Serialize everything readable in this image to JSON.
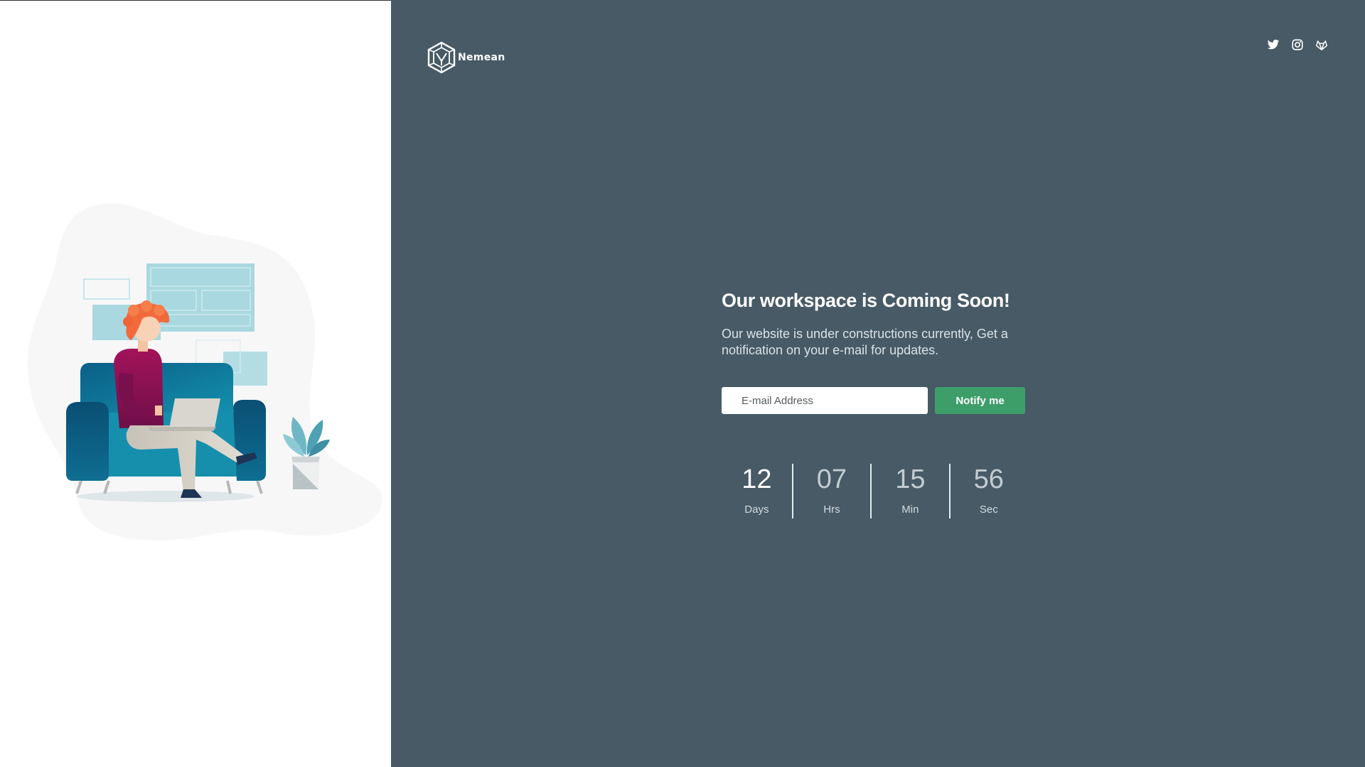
{
  "brand": {
    "name": "Nemean"
  },
  "social": {
    "items": [
      {
        "name": "twitter-icon"
      },
      {
        "name": "instagram-icon"
      },
      {
        "name": "gitlab-icon"
      }
    ]
  },
  "hero": {
    "headline": "Our workspace is Coming Soon!",
    "lead": "Our website is under constructions currently, Get a notification on your e-mail for updates."
  },
  "form": {
    "email_placeholder": "E-mail Address",
    "email_value": "",
    "submit_label": "Notify me"
  },
  "countdown": {
    "days": {
      "value": "12",
      "label": "Days"
    },
    "hours": {
      "value": "07",
      "label": "Hrs"
    },
    "minutes": {
      "value": "15",
      "label": "Min"
    },
    "seconds": {
      "value": "56",
      "label": "Sec"
    }
  },
  "colors": {
    "panel_bg": "#475a66",
    "accent_button": "#3e9e6a",
    "left_bg": "#ffffff"
  }
}
